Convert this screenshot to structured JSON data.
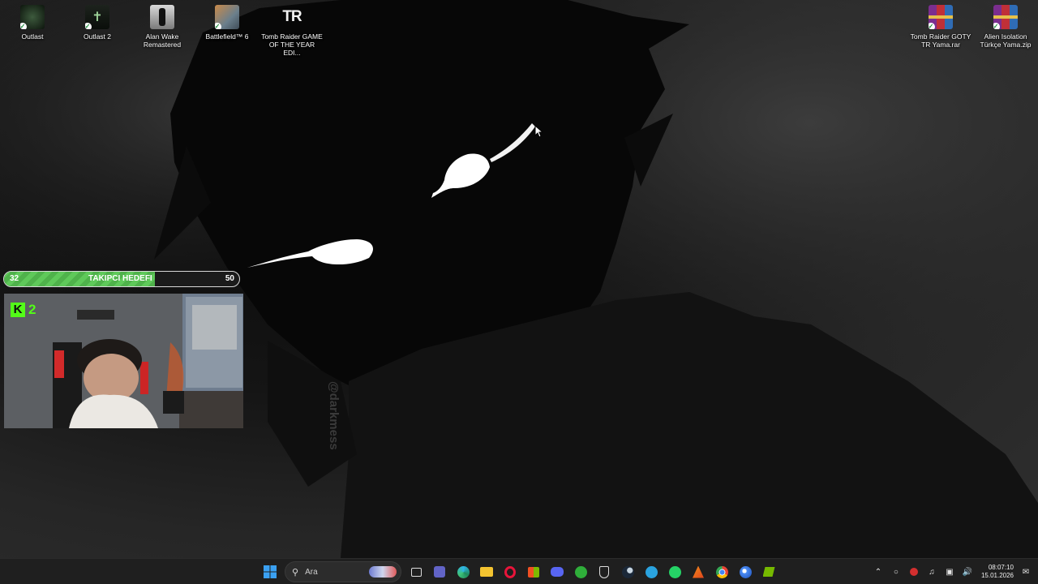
{
  "desktop": {
    "icons_left": [
      {
        "name": "outlast",
        "label": "Outlast"
      },
      {
        "name": "outlast-2",
        "label": "Outlast 2"
      },
      {
        "name": "alan-wake-remastered",
        "label": "Alan Wake Remastered"
      },
      {
        "name": "battlefield-6",
        "label": "Battlefield™ 6"
      },
      {
        "name": "tomb-raider-goty",
        "label": "Tomb Raider GAME OF THE YEAR EDI..."
      }
    ],
    "icons_right": [
      {
        "name": "tomb-raider-goty-tr-yama",
        "label": "Tomb Raider GOTY TR Yama.rar"
      },
      {
        "name": "alien-isolation-yama",
        "label": "Alien Isolation Türkçe Yama.zip"
      }
    ],
    "tomb_raider_logo": "TR",
    "wallpaper_watermark": "@darkmess"
  },
  "stream_overlay": {
    "goal": {
      "current": "32",
      "title": "TAKIPCI HEDEFI",
      "target": "50",
      "progress_fraction": 0.64
    },
    "kick_badge": {
      "logo": "K",
      "count": "2"
    }
  },
  "taskbar": {
    "search_placeholder": "Ara",
    "pinned_apps": [
      "task-view-icon",
      "teams-icon",
      "edge-icon",
      "file-explorer-icon",
      "opera-gx-icon",
      "microsoft-store-icon",
      "discord-icon",
      "xbox-icon",
      "epic-games-icon",
      "steam-icon",
      "telegram-icon",
      "whatsapp-icon",
      "office-icon",
      "chrome-icon",
      "browser-icon",
      "nvidia-icon"
    ],
    "clock": {
      "time": "08:07:10",
      "date": "15.01.2026"
    }
  },
  "colors": {
    "goal_fill": "#5fc95a",
    "kick_green": "#53fc18",
    "taskbar_bg": "#1f1f1f"
  }
}
